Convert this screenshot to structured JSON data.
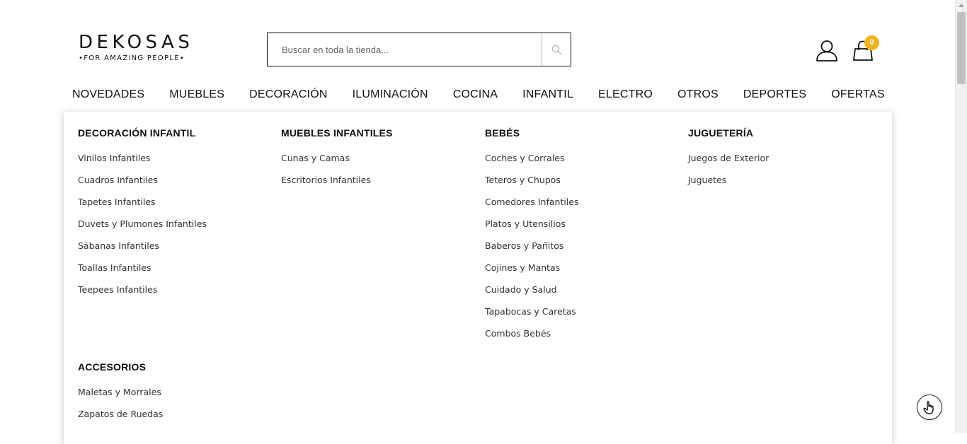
{
  "logo": {
    "brand": "DEKOSAS",
    "tagline": "•FOR AMAZiNG PEOPLE•"
  },
  "search": {
    "placeholder": "Buscar en toda la tienda...",
    "icon": "search-icon"
  },
  "cart": {
    "count": "0",
    "badge_color": "#f2b31c"
  },
  "nav": {
    "items": [
      "NOVEDADES",
      "MUEBLES",
      "DECORACIÓN",
      "ILUMINACIÓN",
      "COCINA",
      "INFANTIL",
      "ELECTRO",
      "OTROS",
      "DEPORTES",
      "OFERTAS"
    ]
  },
  "menu": {
    "decoracion_infantil": {
      "title": "DECORACIÓN INFANTIL",
      "items": [
        "Vinilos Infantiles",
        "Cuadros Infantiles",
        "Tapetes Infantiles",
        "Duvets y Plumones Infantiles",
        "Sábanas Infantiles",
        "Toallas Infantiles",
        "Teepees Infantiles"
      ]
    },
    "muebles_infantiles": {
      "title": "MUEBLES INFANTILES",
      "items": [
        "Cunas y Camas",
        "Escritorios Infantiles"
      ]
    },
    "bebes": {
      "title": "BEBÉS",
      "items": [
        "Coches y Corrales",
        "Teteros y Chupos",
        "Comedores Infantiles",
        "Platos y Utensilios",
        "Baberos y Pañitos",
        "Cojines y Mantas",
        "Cuidado y Salud",
        "Tapabocas y Caretas",
        "Combos Bebés"
      ]
    },
    "jugueteria": {
      "title": "JUGUETERÍA",
      "items": [
        "Juegos de Exterior",
        "Juguetes"
      ]
    },
    "accesorios": {
      "title": "ACCESORIOS",
      "items": [
        "Maletas y Morrales",
        "Zapatos de Ruedas"
      ]
    }
  }
}
